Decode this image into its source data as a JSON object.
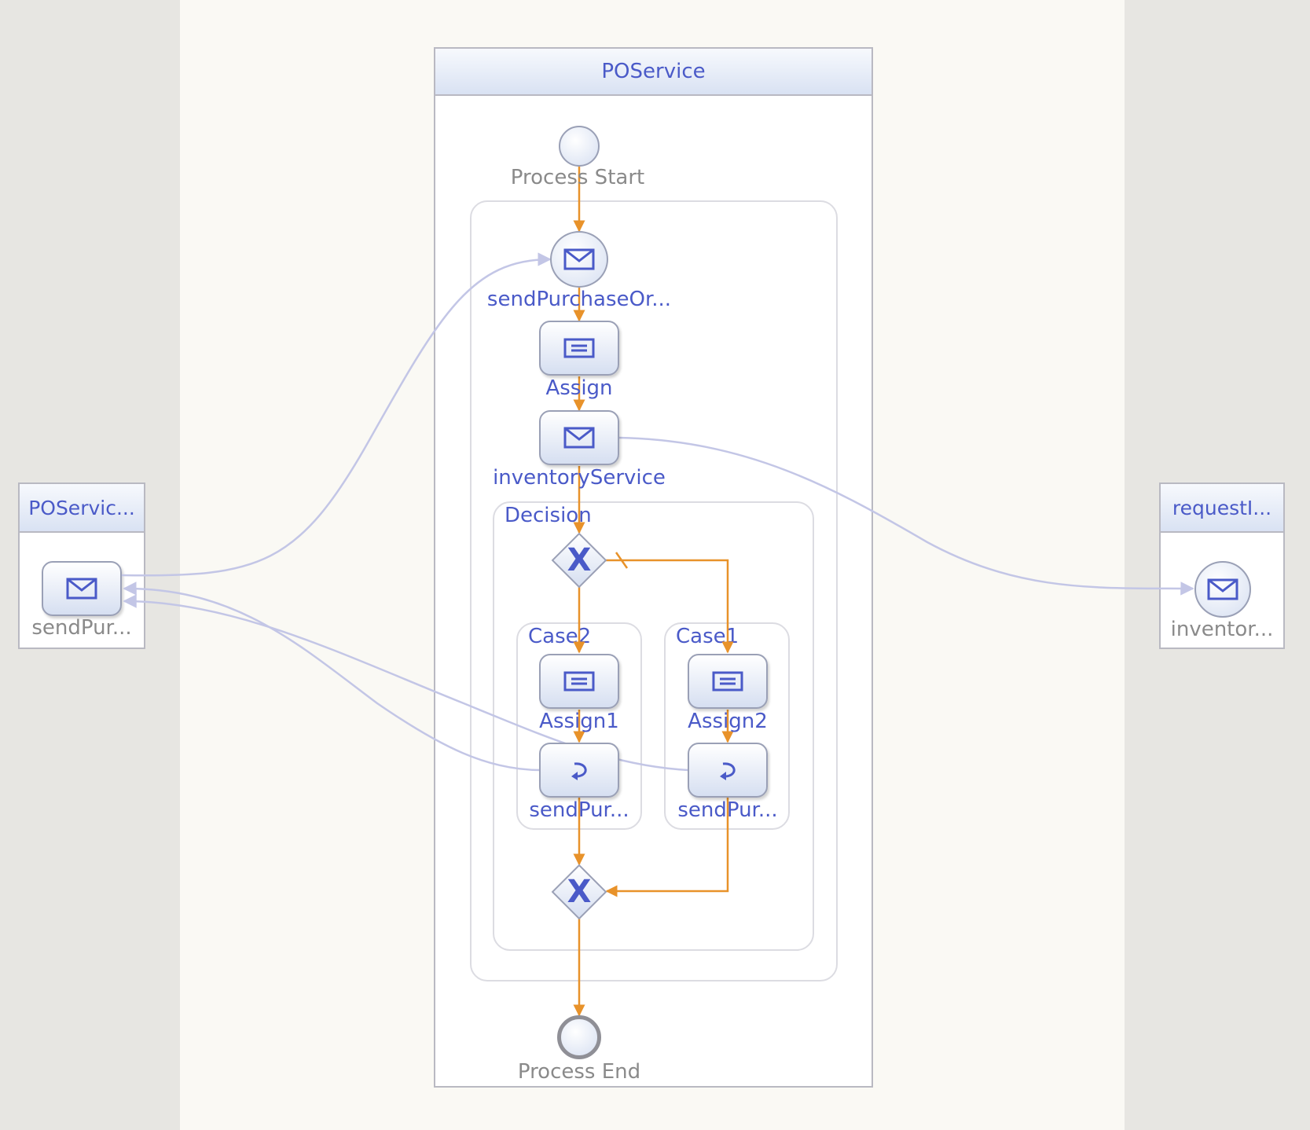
{
  "pools": {
    "main": {
      "title": "POService"
    },
    "left": {
      "title": "POServic...",
      "node_label": "sendPur..."
    },
    "right": {
      "title": "requestI...",
      "node_label": "inventor..."
    }
  },
  "nodes": {
    "process_start": "Process Start",
    "send_purchase_order": "sendPurchaseOr...",
    "assign": "Assign",
    "inventory_service": "inventoryService",
    "decision": "Decision",
    "case2": "Case2",
    "case1": "Case1",
    "assign1": "Assign1",
    "assign2": "Assign2",
    "reply_case2": "sendPur...",
    "reply_case1": "sendPur...",
    "process_end": "Process End"
  },
  "icons": {
    "message": "envelope-icon",
    "assign": "list-icon",
    "reply": "reply-arrow-icon",
    "gateway": "x-gateway-icon"
  },
  "colors": {
    "sequence_flow": "#e8922a",
    "message_flow": "#c3c6e6",
    "label_blue": "#4a5ac8",
    "label_gray": "#8a8a8a",
    "background": "#faf9f4",
    "side_background": "#e7e6e2"
  }
}
